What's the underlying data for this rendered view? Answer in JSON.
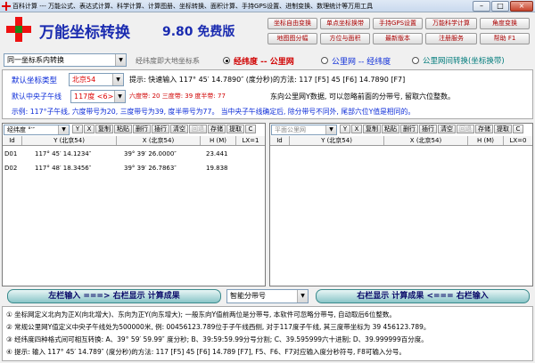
{
  "window": {
    "title": "百科计算 --- 万能公式、表达式计算、科学计算、计算图册、坐标转换、面积计算、手持GPS设置、进制变换、数理统计等万用工具",
    "min": "–",
    "max": "□",
    "close": "×"
  },
  "header": {
    "title": "万能坐标转换",
    "version": "9.80 免费版",
    "buttons": [
      "坐标自由变换",
      "单点坐标换带",
      "手持GPS设置",
      "万能科学计算",
      "角度变换",
      "地图图分幅",
      "方位与面积",
      "最新版本",
      "注册服务",
      "帮助 F1"
    ]
  },
  "row1": {
    "mode_select": "同一坐标系内转换",
    "mode_hint": "经纬度即大地坐标系",
    "options": [
      "经纬度 -- 公里网",
      "公里网 -- 经纬度",
      "公里网间转换(坐标换带)"
    ],
    "selected": 0
  },
  "info": {
    "coord_type_label": "默认坐标类型",
    "coord_type_value": "北京54",
    "hint": "提示: 快速输入 117° 45′ 14.7890″ (度分秒)的方法: 117 [F5] 45 [F6] 14.7890 [F7]",
    "meridian_label": "默认中央子午线",
    "meridian_value": "117度 <6>",
    "zone_info": "六度带: 20  三度带: 39  度半带: 77",
    "east_hint": "东向公里网Y数据, 可以忽略前面的分带号, 留取六位整数。",
    "example": "示例: 117°子午线, 六度带号为20, 三度带号为39, 度半带号为77。 当中央子午线确定后, 除分带号不同外, 尾部六位Y值是相同的。"
  },
  "left_grid": {
    "format_select": "经纬度 °′″",
    "tools": [
      "Y",
      "X",
      "复制",
      "粘贴",
      "删行",
      "插行",
      "清空",
      "回退",
      "存储",
      "提取",
      "C"
    ],
    "columns": [
      "Id",
      "Y (北京54)",
      "X (北京54)",
      "H (M)",
      "LX=1"
    ],
    "rows": [
      {
        "id": "D01",
        "y": "117° 45′ 14.1234″",
        "x": "39° 39′ 26.0000″",
        "h": "23.441",
        "lx": ""
      },
      {
        "id": "D02",
        "y": "117° 48′ 18.3456″",
        "x": "39° 39′ 26.7863″",
        "h": "19.838",
        "lx": ""
      }
    ]
  },
  "right_grid": {
    "format_select": "平面公里网",
    "tools": [
      "Y",
      "X",
      "复制",
      "粘贴",
      "删行",
      "插行",
      "清空",
      "回退",
      "存储",
      "提取",
      "C"
    ],
    "columns": [
      "Id",
      "Y (北京54)",
      "X (北京54)",
      "H (M)",
      "LX=0"
    ],
    "rows": []
  },
  "bottom": {
    "left_button": "左栏输入 ===> 右栏显示 计算成果",
    "zone_select": "智能分带号",
    "right_button": "右栏显示 计算成果 <=== 右栏输入"
  },
  "notes": [
    "① 坐标网定义北向为正X(向北增大)、东向为正Y(向东增大); 一般东向Y值前两位是分带号, 本软件可忽略分带号, 自动取后6位整数。",
    "② 常规公里网Y值定义中央子午线处为500000米, 例: 00456123.789位于子午线西侧, 对于117度子午线, 其三度带坐标为 39 456123.789。",
    "③ 经纬度四种格式间可相互转换: A、39° 59′ 59.99″ 度分秒; B、39:59:59.99分号分割; C、39.595999六十进制; D、39.999999百分度。",
    "④ 提示: 输入 117° 45′ 14.789″ (度分秒)的方法: 117 [F5] 45 [F6] 14.789 [F7], F5、F6、F7对应输入度分秒符号, F8可输入分号。"
  ]
}
